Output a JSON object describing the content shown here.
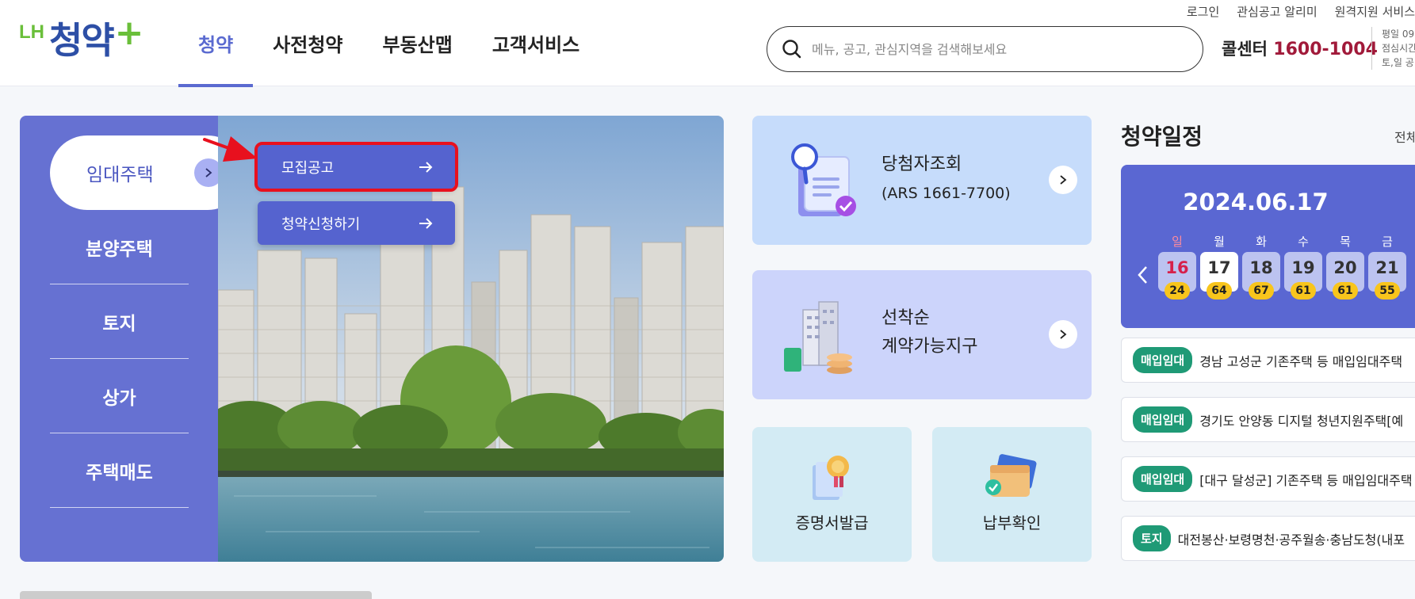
{
  "header": {
    "util_links": [
      "로그인",
      "관심공고 알리미",
      "원격지원 서비스"
    ],
    "logo": {
      "lh": "LH",
      "name": "청약",
      "plus": "+"
    },
    "gnb": [
      {
        "label": "청약",
        "active": true
      },
      {
        "label": "사전청약",
        "active": false
      },
      {
        "label": "부동산맵",
        "active": false
      },
      {
        "label": "고객서비스",
        "active": false
      }
    ],
    "search_placeholder": "메뉴, 공고, 관심지역을 검색해보세요",
    "callcenter_label": "콜센터",
    "callcenter_number": "1600-1004",
    "callcenter_info": [
      "평일 09",
      "점심시간",
      "토,일 공"
    ]
  },
  "left_menu": {
    "active": "임대주택",
    "items": [
      "분양주택",
      "토지",
      "상가",
      "주택매도"
    ]
  },
  "submenu": [
    {
      "label": "모집공고",
      "highlighted": true
    },
    {
      "label": "청약신청하기",
      "highlighted": false
    }
  ],
  "cards": {
    "winner": {
      "title": "당첨자조회",
      "subtitle": "(ARS 1661-7700)"
    },
    "firstcome": {
      "title_line1": "선착순",
      "title_line2": "계약가능지구"
    },
    "cert": {
      "label": "증명서발급"
    },
    "payment": {
      "label": "납부확인"
    }
  },
  "schedule": {
    "title": "청약일정",
    "all_link": "전체",
    "date": "2024.06.17",
    "days": [
      {
        "dow": "일",
        "day": "16",
        "count": "24",
        "sunday": true,
        "today": false
      },
      {
        "dow": "월",
        "day": "17",
        "count": "64",
        "sunday": false,
        "today": true
      },
      {
        "dow": "화",
        "day": "18",
        "count": "67",
        "sunday": false,
        "today": false
      },
      {
        "dow": "수",
        "day": "19",
        "count": "61",
        "sunday": false,
        "today": false
      },
      {
        "dow": "목",
        "day": "20",
        "count": "61",
        "sunday": false,
        "today": false
      },
      {
        "dow": "금",
        "day": "21",
        "count": "55",
        "sunday": false,
        "today": false
      }
    ],
    "notices": [
      {
        "tag": "매입임대",
        "text": "경남 고성군 기존주택 등 매입임대주택"
      },
      {
        "tag": "매입임대",
        "text": "경기도 안양동 디지털 청년지원주택[예"
      },
      {
        "tag": "매입임대",
        "text": "[대구 달성군] 기존주택 등 매입임대주택"
      },
      {
        "tag": "토지",
        "text": "대전봉산·보령명천·공주월송·충남도청(내포"
      }
    ]
  },
  "colors": {
    "primary": "#5a67d2",
    "menu_bg": "#6671d2",
    "callcenter_num": "#a11a3a",
    "tag_green": "#1f9a76",
    "badge_yellow": "#f8c51c",
    "highlight_red": "#e8101e"
  }
}
